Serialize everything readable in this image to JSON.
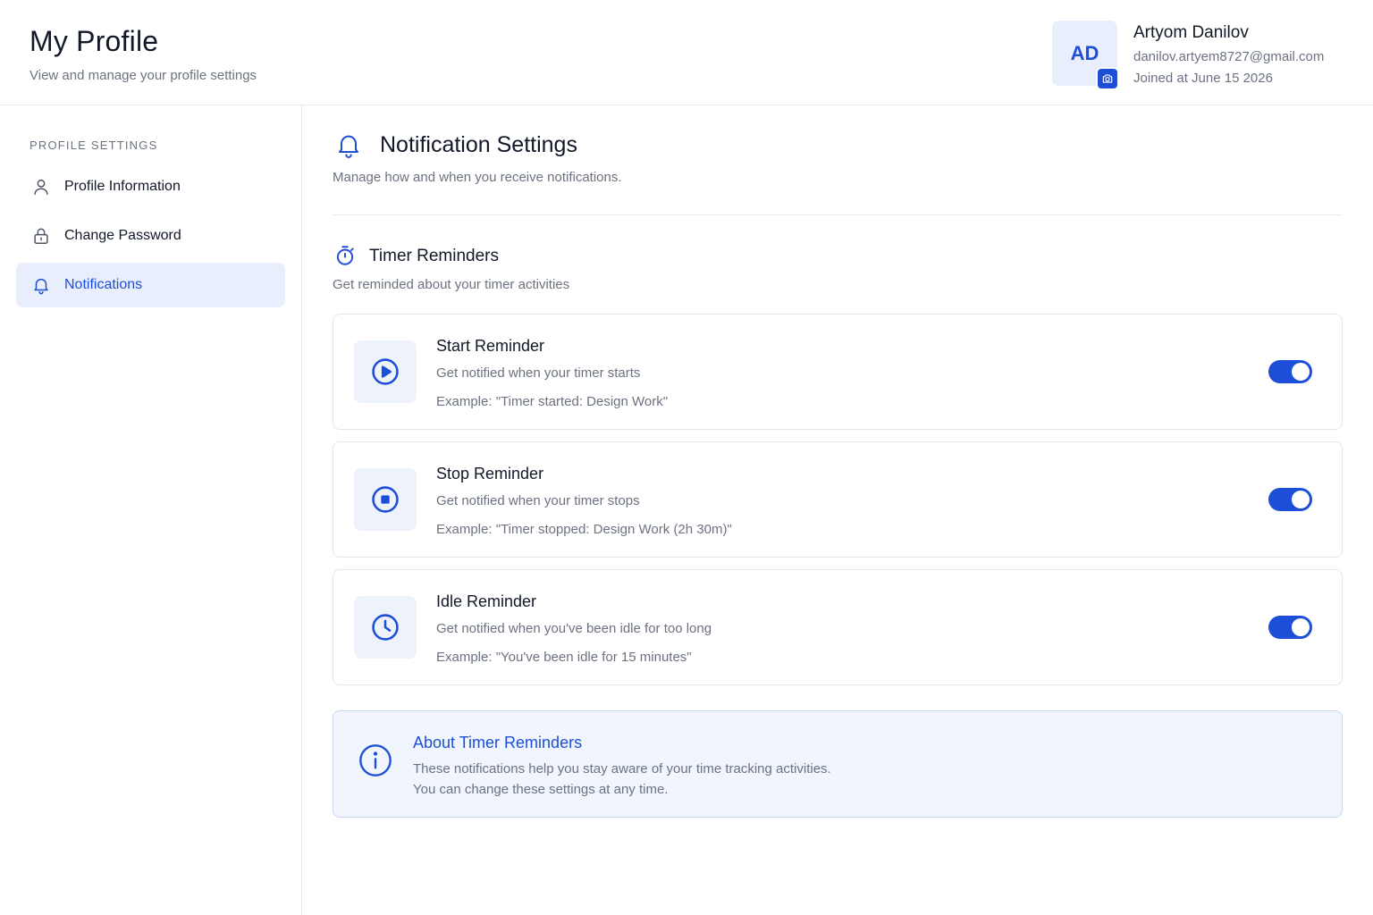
{
  "header": {
    "title": "My Profile",
    "subtitle": "View and manage your profile settings"
  },
  "user": {
    "initials": "AD",
    "name": "Artyom Danilov",
    "email": "danilov.artyem8727@gmail.com",
    "joined": "Joined at June 15 2026",
    "avatar_action_icon": "camera-icon"
  },
  "sidebar": {
    "heading": "PROFILE SETTINGS",
    "items": [
      {
        "label": "Profile Information",
        "icon": "user-icon",
        "active": false
      },
      {
        "label": "Change Password",
        "icon": "lock-icon",
        "active": false
      },
      {
        "label": "Notifications",
        "icon": "bell-icon",
        "active": true
      }
    ]
  },
  "main": {
    "title": "Notification Settings",
    "subtitle": "Manage how and when you receive notifications.",
    "group": {
      "title": "Timer Reminders",
      "subtitle": "Get reminded about your timer activities",
      "icon": "timer-icon"
    },
    "reminders": [
      {
        "title": "Start Reminder",
        "description": "Get notified when your timer starts",
        "example": "Example: \"Timer started: Design Work\"",
        "icon": "play-icon",
        "enabled": true
      },
      {
        "title": "Stop Reminder",
        "description": "Get notified when your timer stops",
        "example": "Example: \"Timer stopped: Design Work (2h 30m)\"",
        "icon": "stop-icon",
        "enabled": true
      },
      {
        "title": "Idle Reminder",
        "description": "Get notified when you've been idle for too long",
        "example": "Example: \"You've been idle for 15 minutes\"",
        "icon": "clock-icon",
        "enabled": true
      }
    ],
    "info": {
      "title": "About Timer Reminders",
      "line1": "These notifications help you stay aware of your time tracking activities.",
      "line2": "You can change these settings at any time.",
      "icon": "info-icon"
    }
  },
  "colors": {
    "accent": "#1d4ed8",
    "accent_light": "#e8eefb",
    "text_primary": "#111827",
    "text_muted": "#6b7280",
    "border": "#e5e7eb"
  }
}
